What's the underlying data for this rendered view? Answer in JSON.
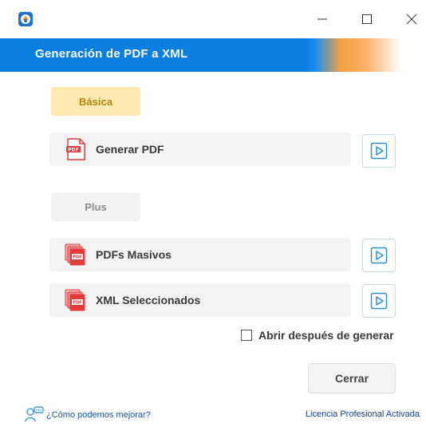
{
  "window": {
    "title": "Generación de PDF a XML"
  },
  "titlebar": {
    "minimize_glyph": "—",
    "maximize_glyph": "☐",
    "close_glyph": "✕"
  },
  "sections": {
    "basica": "Básica",
    "plus": "Plus"
  },
  "actions": [
    {
      "label": "Generar PDF",
      "icon": "pdf-file-icon"
    },
    {
      "label": "PDFs Masivos",
      "icon": "multi-pdf-icon"
    },
    {
      "label": "XML Seleccionados",
      "icon": "multi-pdf-icon"
    }
  ],
  "checkbox": {
    "label": "Abrir después de generar",
    "checked": false
  },
  "buttons": {
    "close": "Cerrar"
  },
  "footer": {
    "feedback": "¿Cómo podemos mejorar?",
    "license": "Licencia Profesional Activada"
  },
  "colors": {
    "header_blue": "#0a7fe0",
    "basica_bg": "#fde9b2",
    "basica_text": "#b7860b",
    "pdf_red": "#e23b3b",
    "play_blue": "#2a8fd8"
  }
}
